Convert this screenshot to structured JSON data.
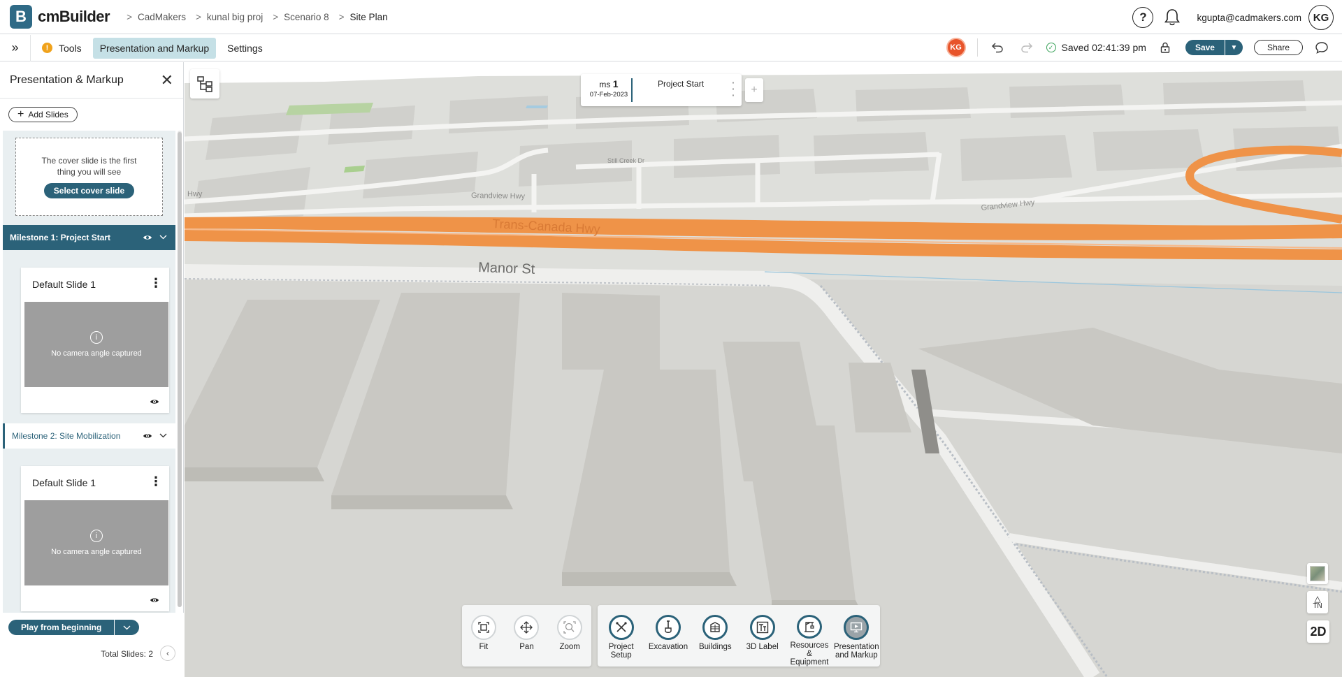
{
  "app": {
    "brand": "cmBuilder",
    "brand_letter": "B"
  },
  "breadcrumb": [
    "CadMakers",
    "kunal big proj",
    "Scenario 8",
    "Site Plan"
  ],
  "header": {
    "help": "?",
    "user_email": "kgupta@cadmakers.com",
    "avatar": "KG"
  },
  "toolbar": {
    "expand": "»",
    "tools_label": "Tools",
    "tools_warning": "!",
    "presentation_label": "Presentation and Markup",
    "settings_label": "Settings",
    "collab_badge": "KG",
    "saved_text": "Saved 02:41:39 pm",
    "save_label": "Save",
    "share_label": "Share"
  },
  "panel": {
    "title": "Presentation & Markup",
    "add_slides": "Add Slides",
    "cover_text": "The cover slide is the first thing you will see",
    "cover_button": "Select cover slide",
    "milestones": [
      {
        "label": "Milestone 1: Project Start",
        "slide_title": "Default Slide 1",
        "thumb_text": "No camera angle captured"
      },
      {
        "label": "Milestone 2: Site Mobilization",
        "slide_title": "Default Slide 1",
        "thumb_text": "No camera angle captured"
      }
    ],
    "play_label": "Play from beginning",
    "total_slides": "Total Slides: 2"
  },
  "milestone_tab": {
    "prefix": "ms",
    "number": "1",
    "date": "07-Feb-2023",
    "name": "Project Start"
  },
  "map_labels": {
    "street1": "Manor St",
    "highway1": "Trans-Canada Hwy",
    "street2": "Grandview Hwy",
    "street3": "Grandview Hwy",
    "street4": "Still Creek Dr",
    "highway_left": "Hwy"
  },
  "nav_tools": [
    {
      "label": "Fit",
      "icon": "fit-icon"
    },
    {
      "label": "Pan",
      "icon": "pan-icon"
    },
    {
      "label": "Zoom",
      "icon": "zoom-icon"
    }
  ],
  "main_tools": [
    {
      "label": "Project Setup",
      "icon": "wrench-icon"
    },
    {
      "label": "Excavation",
      "icon": "shovel-icon"
    },
    {
      "label": "Buildings",
      "icon": "building-icon"
    },
    {
      "label": "3D Label",
      "icon": "text-label-icon"
    },
    {
      "label": "Resources & Equipment",
      "icon": "crane-icon"
    },
    {
      "label": "Presentation and Markup",
      "icon": "presentation-icon"
    }
  ],
  "view_controls": {
    "north": "TN",
    "mode": "2D"
  },
  "colors": {
    "accent": "#2b6279",
    "highway": "#ef9348",
    "badge": "#e8542a",
    "warning": "#f0a21b"
  }
}
